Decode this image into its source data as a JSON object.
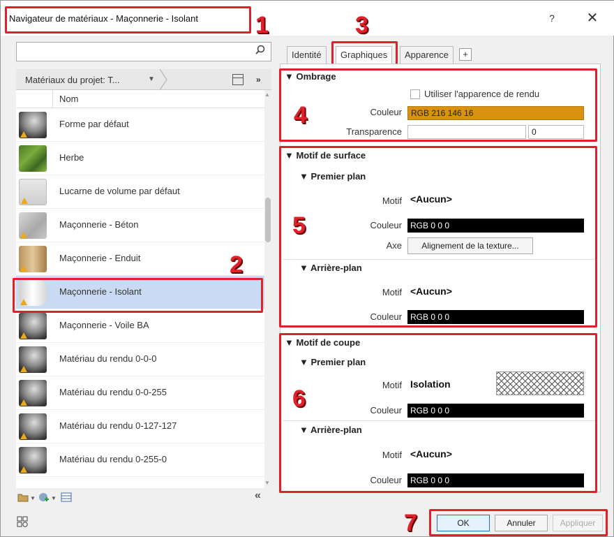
{
  "window": {
    "title": "Navigateur de matériaux - Maçonnerie - Isolant",
    "help": "?",
    "close": "✕"
  },
  "annotations": [
    "1",
    "2",
    "3",
    "4",
    "5",
    "6",
    "7"
  ],
  "left": {
    "search_placeholder": "",
    "breadcrumb": "Matériaux du projet: T...",
    "column_header": "Nom",
    "items": [
      {
        "label": "Forme par défaut",
        "thumb": "sphere-grey"
      },
      {
        "label": "Herbe",
        "thumb": "grass"
      },
      {
        "label": "Lucarne de volume par défaut",
        "thumb": "window"
      },
      {
        "label": "Maçonnerie - Béton",
        "thumb": "concrete"
      },
      {
        "label": "Maçonnerie - Enduit",
        "thumb": "plaster"
      },
      {
        "label": "Maçonnerie - Isolant",
        "thumb": "insulation",
        "selected": true
      },
      {
        "label": "Maçonnerie - Voile BA",
        "thumb": "sphere-grey"
      },
      {
        "label": "Matériau du rendu 0-0-0",
        "thumb": "sphere-grey"
      },
      {
        "label": "Matériau du rendu 0-0-255",
        "thumb": "sphere-grey"
      },
      {
        "label": "Matériau du rendu 0-127-127",
        "thumb": "sphere-grey"
      },
      {
        "label": "Matériau du rendu 0-255-0",
        "thumb": "sphere-grey"
      }
    ],
    "collapse_label": "«"
  },
  "tabs": {
    "identite": "Identité",
    "graphiques": "Graphiques",
    "apparence": "Apparence",
    "add": "+"
  },
  "ombrage": {
    "title": "▼ Ombrage",
    "use_render_label": "Utiliser l'apparence de rendu",
    "couleur_label": "Couleur",
    "couleur_value": "RGB 216 146 16",
    "couleur_hex": "#d8920f",
    "transparence_label": "Transparence",
    "transparence_value": "0"
  },
  "surface": {
    "title": "▼ Motif de surface",
    "premier_title": "▼ Premier plan",
    "motif_label": "Motif",
    "motif_value": "<Aucun>",
    "couleur_label": "Couleur",
    "couleur_value": "RGB 0 0 0",
    "axe_label": "Axe",
    "axe_value": "Alignement de la texture...",
    "arriere_title": "▼ Arrière-plan",
    "arriere_motif_label": "Motif",
    "arriere_motif_value": "<Aucun>",
    "arriere_couleur_label": "Couleur",
    "arriere_couleur_value": "RGB 0 0 0"
  },
  "coupe": {
    "title": "▼ Motif de coupe",
    "premier_title": "▼ Premier plan",
    "motif_label": "Motif",
    "motif_value": "Isolation",
    "couleur_label": "Couleur",
    "couleur_value": "RGB 0 0 0",
    "arriere_title": "▼ Arrière-plan",
    "arriere_motif_label": "Motif",
    "arriere_motif_value": "<Aucun>",
    "arriere_couleur_label": "Couleur",
    "arriere_couleur_value": "RGB 0 0 0"
  },
  "footer": {
    "ok": "OK",
    "annuler": "Annuler",
    "appliquer": "Appliquer"
  },
  "colors": {
    "annotation_red": "#e0202a",
    "selection": "#c9daf2",
    "accent": "#1a6fc8"
  }
}
